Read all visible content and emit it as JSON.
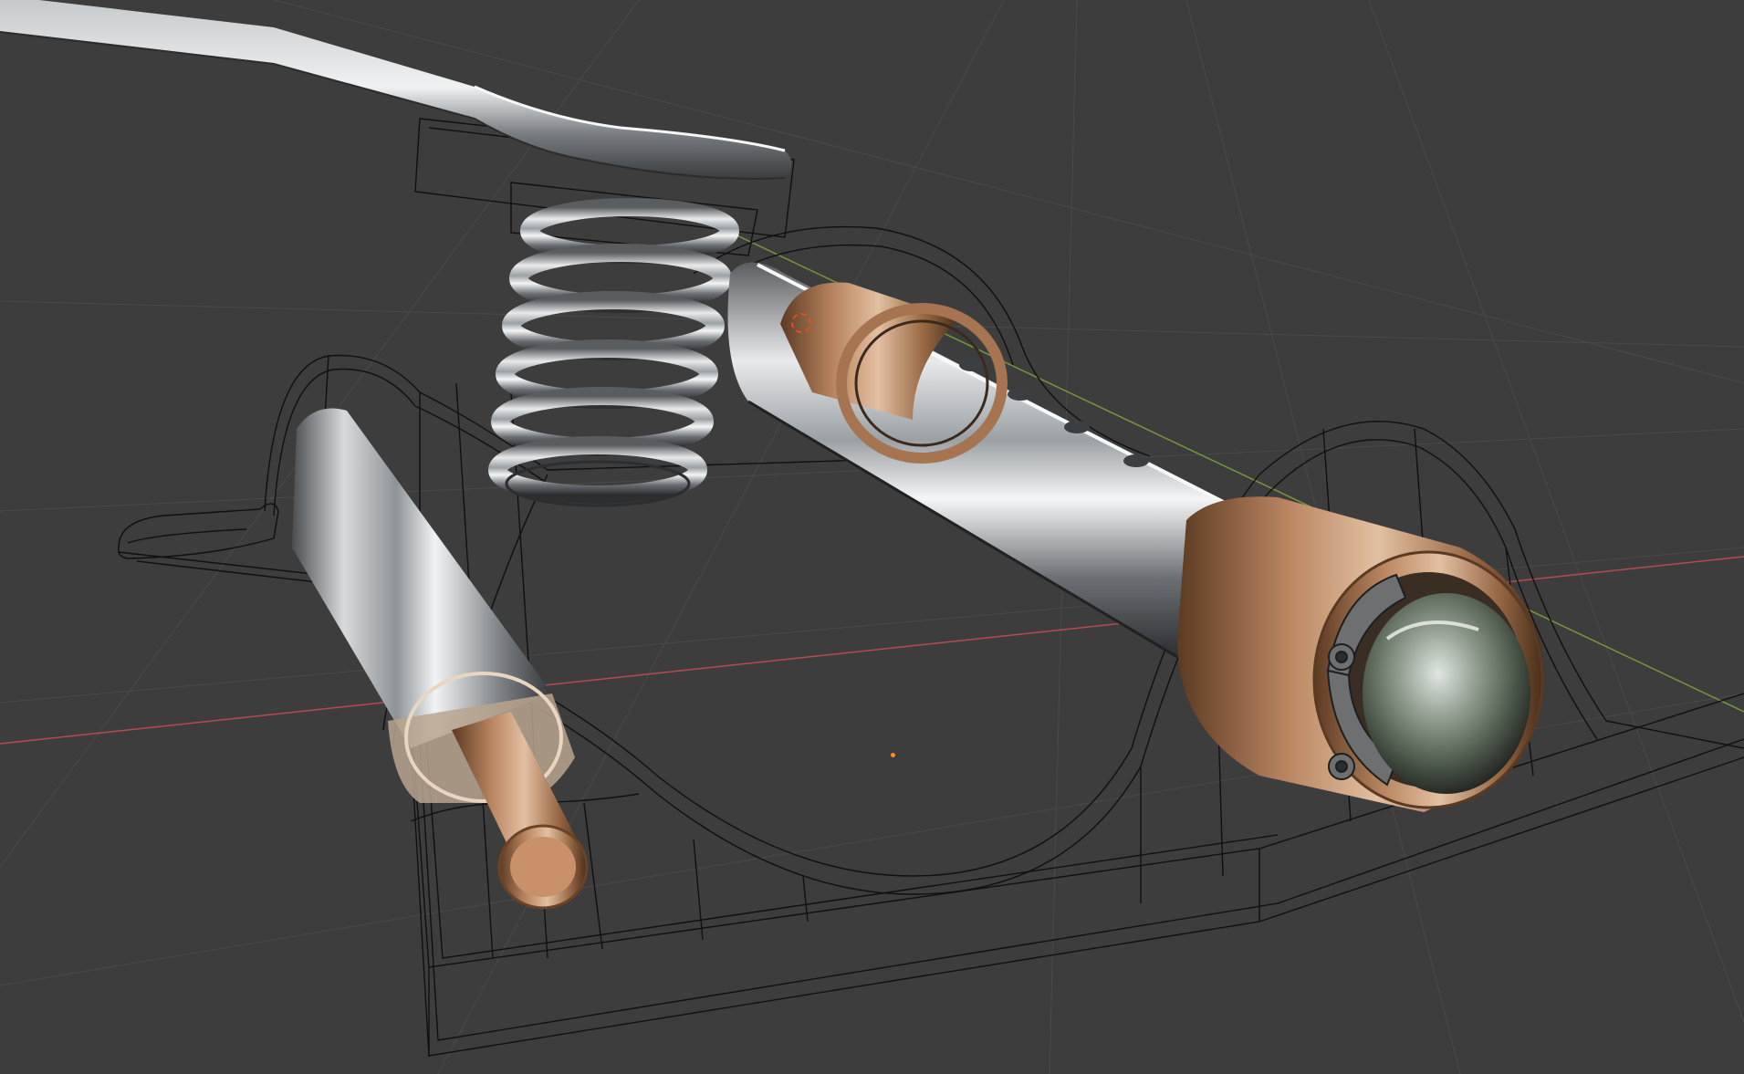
{
  "viewport": {
    "background_color": "#3d3d3d",
    "grid_color": "#4d4d4d",
    "x_axis_color": "#c8474f",
    "y_axis_color": "#7ea23e",
    "wireframe_color": "#0e0e0e",
    "chrome_color": "#c9ccd0",
    "copper_color": "#a8744a"
  },
  "scene": {
    "objects": [
      "lever-arm",
      "compression-spring",
      "roller-pin",
      "plunger-shaft",
      "bushing-front",
      "bushing-rear",
      "ball-end",
      "retaining-clip",
      "housing-wireframe"
    ]
  },
  "overlays": {
    "origin_marker_icon": "origin-dot-icon",
    "cursor_icon": "3d-cursor-icon"
  }
}
